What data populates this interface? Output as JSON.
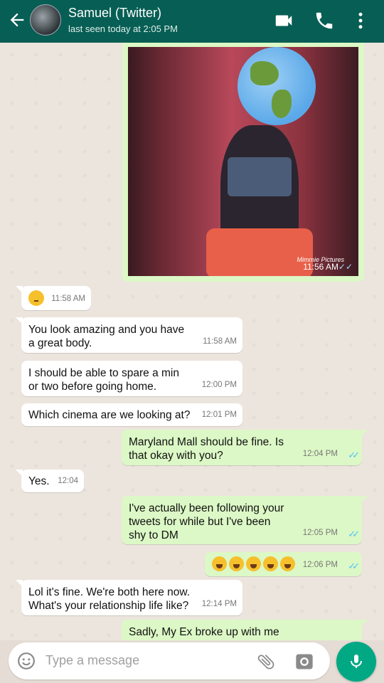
{
  "header": {
    "title": "Samuel (Twitter)",
    "subtitle": "last seen today at 2:05 PM",
    "icons": [
      "back-arrow-icon",
      "video-call-icon",
      "phone-icon",
      "more-vert-icon"
    ]
  },
  "image_message": {
    "time": "11:56 AM",
    "watermark": "Mimmie Pictures",
    "ticks": "✓✓"
  },
  "messages": [
    {
      "dir": "in",
      "text": "",
      "emoji": "flushed-face",
      "time": "11:58 AM"
    },
    {
      "dir": "in",
      "text": "You look amazing and you have\na great body.",
      "time": "11:58 AM"
    },
    {
      "dir": "in",
      "text": "I should be able to spare a min\nor two before going home.",
      "time": "12:00 PM"
    },
    {
      "dir": "in",
      "text": "Which cinema are we looking at?",
      "time": "12:01 PM"
    },
    {
      "dir": "out",
      "text": "Maryland Mall should be fine. Is\nthat okay with you?",
      "time": "12:04 PM",
      "ticks": "✓✓"
    },
    {
      "dir": "in",
      "text": "Yes.",
      "time": "12:04"
    },
    {
      "dir": "out",
      "text": "I've actually been following your\ntweets for while but I've been\nshy to DM",
      "time": "12:05 PM",
      "ticks": "✓✓"
    },
    {
      "dir": "out",
      "text": "",
      "emoji": "weary-face-x5",
      "time": "12:06 PM",
      "ticks": "✓✓"
    },
    {
      "dir": "in",
      "text": "Lol it's fine. We're both here now.\nWhat's your relationship life like?",
      "time": "12:14 PM"
    },
    {
      "dir": "out",
      "text": "Sadly, My Ex broke up with me",
      "time": ""
    }
  ],
  "input": {
    "placeholder": "Type a message",
    "icons": [
      "emoji-icon",
      "attach-icon",
      "camera-icon",
      "mic-icon"
    ]
  },
  "colors": {
    "header": "#075e54",
    "outgoing_bubble": "#dcf8c6",
    "incoming_bubble": "#ffffff",
    "read_ticks": "#4fc3f7",
    "mic_button": "#00a884"
  }
}
